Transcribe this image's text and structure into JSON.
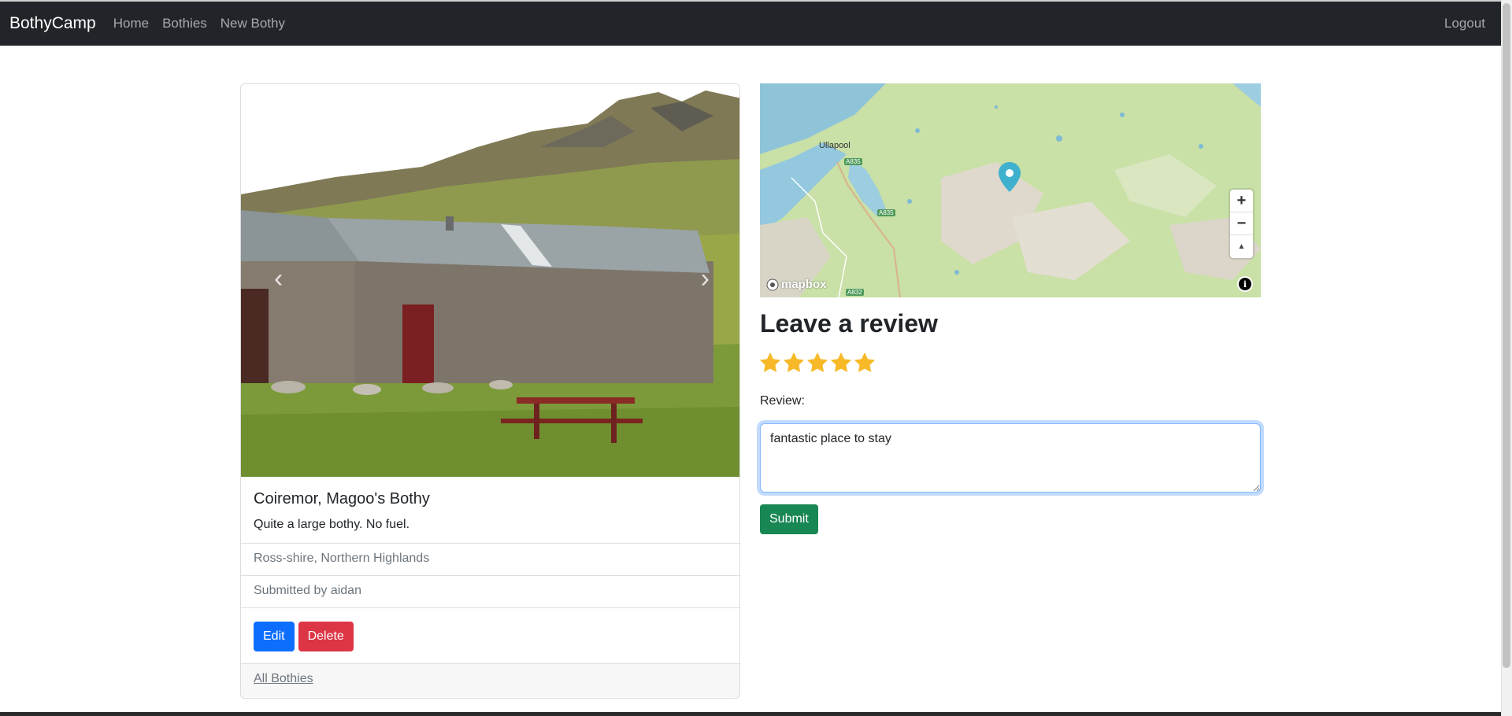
{
  "navbar": {
    "brand": "BothyCamp",
    "links": [
      "Home",
      "Bothies",
      "New Bothy"
    ],
    "logout": "Logout"
  },
  "bothy": {
    "title": "Coiremor, Magoo's Bothy",
    "description": "Quite a large bothy. No fuel.",
    "location": "Ross-shire, Northern Highlands",
    "submitted_by": "Submitted by aidan",
    "edit_label": "Edit",
    "delete_label": "Delete",
    "all_link": "All Bothies"
  },
  "map": {
    "town_label": "Ullapool",
    "road_labels": [
      "A835",
      "A835",
      "A832"
    ],
    "attribution": "mapbox",
    "zoom_in": "+",
    "zoom_out": "−",
    "compass": "▲",
    "info": "i"
  },
  "review": {
    "heading": "Leave a review",
    "rating": 5,
    "rating_max": 5,
    "label": "Review:",
    "text": "fantastic place to stay",
    "submit_label": "Submit"
  },
  "colors": {
    "navbar": "#212529",
    "primary": "#0d6efd",
    "danger": "#dc3545",
    "success": "#198754",
    "star": "#f7b928",
    "marker": "#3fb1ce"
  }
}
